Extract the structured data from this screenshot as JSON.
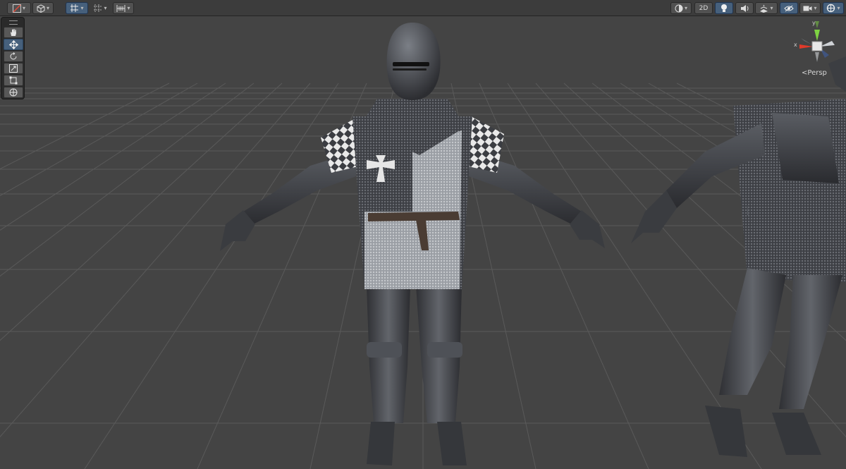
{
  "toolbar": {
    "left_tools": [
      {
        "icon": "draw-mode-icon"
      },
      {
        "icon": "render-cube-icon"
      },
      {
        "icon": "grid-snap-icon",
        "active": true
      },
      {
        "icon": "increment-snap-icon"
      },
      {
        "icon": "grid-ruler-icon"
      }
    ],
    "right_tools": [
      {
        "icon": "shading-mode-icon"
      },
      {
        "label": "2D"
      },
      {
        "icon": "lighting-bulb-icon",
        "active": true
      },
      {
        "icon": "audio-icon"
      },
      {
        "icon": "effects-icon"
      },
      {
        "icon": "hidden-objects-eye-icon"
      },
      {
        "icon": "camera-icon"
      },
      {
        "icon": "gizmos-icon",
        "active": true
      }
    ]
  },
  "tools_overlay": [
    "view-hand-tool",
    "move-tool",
    "rotate-tool",
    "scale-tool",
    "rect-tool",
    "transform-tool"
  ],
  "orientation_gizmo": {
    "projection_label": "Persp",
    "axis_y": "y",
    "axis_x": "x"
  },
  "colors": {
    "viewport_background": "#444444",
    "grid_line": "#5b5b5b",
    "toolbar_active": "#46607c",
    "axis_x": "#e03a2a",
    "axis_y": "#7ed342",
    "axis_z": "#3b6fd6"
  }
}
